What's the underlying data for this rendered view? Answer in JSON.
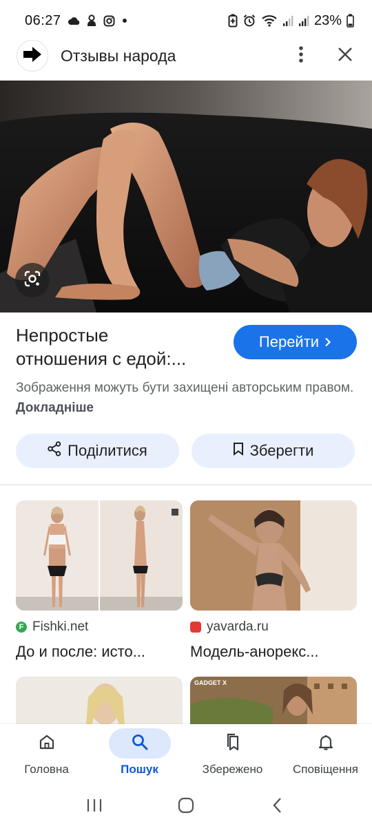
{
  "status_bar": {
    "time": "06:27",
    "battery_percent": "23%",
    "left_icons": [
      "cloud-icon",
      "user-icon",
      "instagram-icon",
      "dot-icon"
    ],
    "right_icons": [
      "battery-saver-icon",
      "alarm-icon",
      "wifi-icon",
      "signal-icon",
      "signal-icon",
      "battery-icon"
    ]
  },
  "header": {
    "title": "Отзывы народа",
    "logo_icon": "arrow-right-icon",
    "menu_icon": "more-vert-icon",
    "close_icon": "close-icon"
  },
  "result": {
    "title_line1": "Непростые",
    "title_line2": "отношения с едой:...",
    "visit_label": "Перейти",
    "copyright_text": "Зображення можуть бути захищені авторським правом.",
    "learn_more": "Докладніше"
  },
  "actions": {
    "share_label": "Поділитися",
    "save_label": "Зберегти"
  },
  "related": [
    {
      "source": "Fishki.net",
      "title": "До и после: исто...",
      "favicon_color": "#34a853",
      "favicon_letter": "F"
    },
    {
      "source": "yavarda.ru",
      "title": "Модель-анорекс...",
      "favicon_color": "#e53935",
      "favicon_letter": ""
    },
    {
      "source": "",
      "title": ""
    },
    {
      "source": "GADGET X",
      "title": ""
    }
  ],
  "bottom_nav": {
    "items": [
      {
        "label": "Головна",
        "icon": "home-icon",
        "active": false
      },
      {
        "label": "Пошук",
        "icon": "search-icon",
        "active": true
      },
      {
        "label": "Збережено",
        "icon": "bookmarks-icon",
        "active": false
      },
      {
        "label": "Сповіщення",
        "icon": "bell-icon",
        "active": false
      }
    ]
  },
  "colors": {
    "accent": "#1a73e8",
    "pill_bg": "#e8f0fe",
    "active_nav": "#0b57d0"
  }
}
